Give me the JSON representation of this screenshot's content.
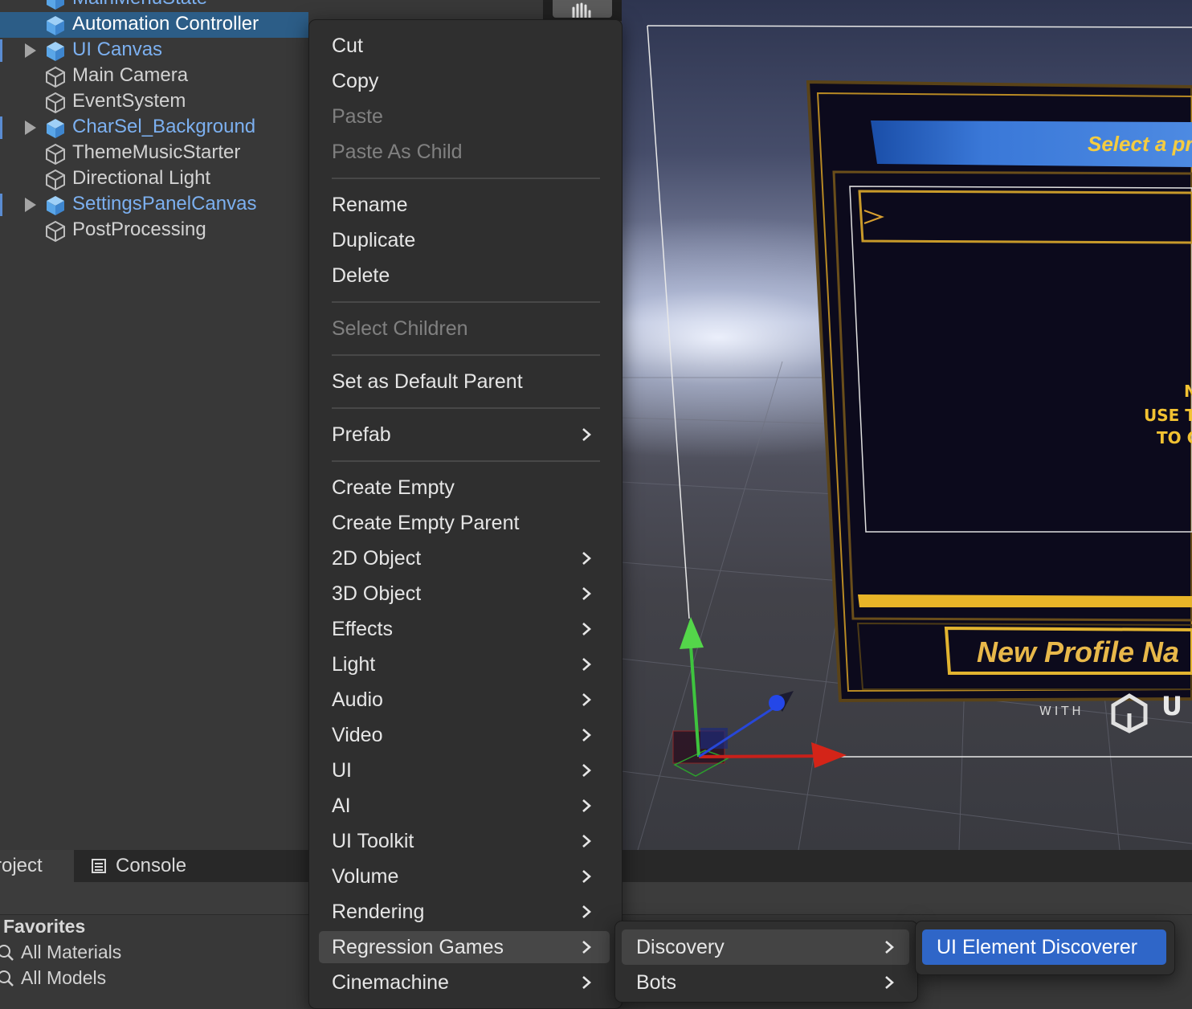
{
  "hierarchy": {
    "items": [
      {
        "label": "MainMenuState",
        "prefab": true,
        "expandable": false,
        "selected": false
      },
      {
        "label": "Automation Controller",
        "prefab": false,
        "expandable": false,
        "selected": true
      },
      {
        "label": "UI Canvas",
        "prefab": true,
        "expandable": true,
        "selected": false
      },
      {
        "label": "Main Camera",
        "prefab": false,
        "expandable": false,
        "selected": false
      },
      {
        "label": "EventSystem",
        "prefab": false,
        "expandable": false,
        "selected": false
      },
      {
        "label": "CharSel_Background",
        "prefab": true,
        "expandable": true,
        "selected": false
      },
      {
        "label": "ThemeMusicStarter",
        "prefab": false,
        "expandable": false,
        "selected": false
      },
      {
        "label": "Directional Light",
        "prefab": false,
        "expandable": false,
        "selected": false
      },
      {
        "label": "SettingsPanelCanvas",
        "prefab": true,
        "expandable": true,
        "selected": false
      },
      {
        "label": "PostProcessing",
        "prefab": false,
        "expandable": false,
        "selected": false
      }
    ]
  },
  "context_menu": {
    "items": [
      {
        "label": "Cut",
        "disabled": false,
        "submenu": false
      },
      {
        "label": "Copy",
        "disabled": false,
        "submenu": false
      },
      {
        "label": "Paste",
        "disabled": true,
        "submenu": false
      },
      {
        "label": "Paste As Child",
        "disabled": true,
        "submenu": false
      },
      {
        "label": "Rename",
        "disabled": false,
        "submenu": false
      },
      {
        "label": "Duplicate",
        "disabled": false,
        "submenu": false
      },
      {
        "label": "Delete",
        "disabled": false,
        "submenu": false
      },
      {
        "label": "Select Children",
        "disabled": true,
        "submenu": false
      },
      {
        "label": "Set as Default Parent",
        "disabled": false,
        "submenu": false
      },
      {
        "label": "Prefab",
        "disabled": false,
        "submenu": true
      },
      {
        "label": "Create Empty",
        "disabled": false,
        "submenu": false
      },
      {
        "label": "Create Empty Parent",
        "disabled": false,
        "submenu": false
      },
      {
        "label": "2D Object",
        "disabled": false,
        "submenu": true
      },
      {
        "label": "3D Object",
        "disabled": false,
        "submenu": true
      },
      {
        "label": "Effects",
        "disabled": false,
        "submenu": true
      },
      {
        "label": "Light",
        "disabled": false,
        "submenu": true
      },
      {
        "label": "Audio",
        "disabled": false,
        "submenu": true
      },
      {
        "label": "Video",
        "disabled": false,
        "submenu": true
      },
      {
        "label": "UI",
        "disabled": false,
        "submenu": true
      },
      {
        "label": "AI",
        "disabled": false,
        "submenu": true
      },
      {
        "label": "UI Toolkit",
        "disabled": false,
        "submenu": true
      },
      {
        "label": "Volume",
        "disabled": false,
        "submenu": true
      },
      {
        "label": "Rendering",
        "disabled": false,
        "submenu": true
      },
      {
        "label": "Regression Games",
        "disabled": false,
        "submenu": true,
        "highlighted": true
      },
      {
        "label": "Cinemachine",
        "disabled": false,
        "submenu": true
      }
    ]
  },
  "submenu_regression_games": {
    "items": [
      {
        "label": "Discovery",
        "submenu": true,
        "highlighted": true
      },
      {
        "label": "Bots",
        "submenu": true
      }
    ]
  },
  "submenu_discovery": {
    "items": [
      {
        "label": "UI Element Discoverer",
        "selected": true
      }
    ]
  },
  "bottom_panel": {
    "tabs": [
      {
        "label": "Project",
        "visible_label": "roject"
      },
      {
        "label": "Console"
      }
    ],
    "favorites_header": "Favorites",
    "favorites": [
      "All Materials",
      "All Models"
    ]
  },
  "scene_view": {
    "banner_text": "Select a pr",
    "profile_text": "New Profile Na",
    "hint_line1": "N",
    "hint_line2": "USE T",
    "hint_line3": "TO C",
    "with_text": "WITH",
    "brand_text": "U"
  },
  "colors": {
    "selection": "#2c5d87",
    "prefab_blue": "#7cb0f0",
    "menu_bg": "#2f2f2f",
    "menu_highlight": "#474747",
    "accent": "#2f66c8",
    "gold": "#f0c030"
  }
}
